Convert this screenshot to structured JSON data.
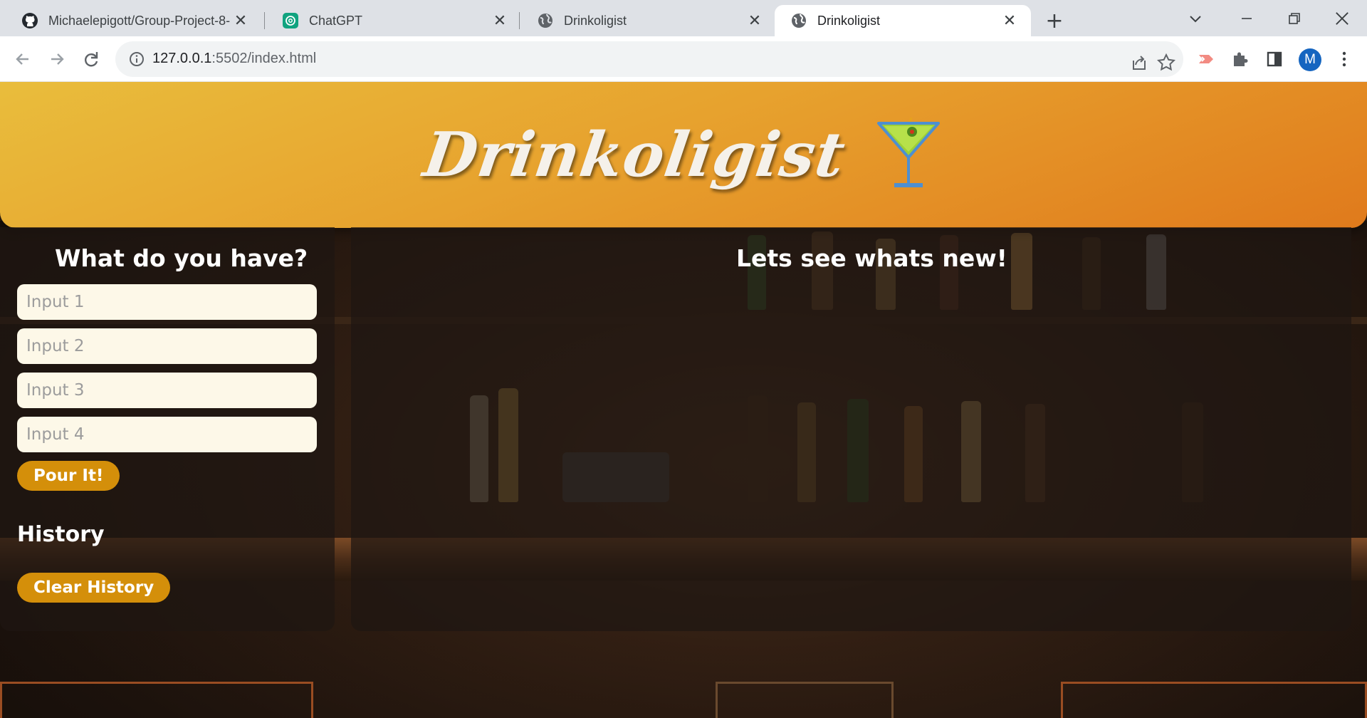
{
  "browser": {
    "tabs": [
      {
        "title": "Michaelepigott/Group-Project-8-",
        "icon": "github-icon",
        "active": false
      },
      {
        "title": "ChatGPT",
        "icon": "chatgpt-icon",
        "active": false
      },
      {
        "title": "Drinkoligist",
        "icon": "globe-icon",
        "active": false
      },
      {
        "title": "Drinkoligist",
        "icon": "globe-icon",
        "active": true
      }
    ],
    "tab_close_glyph": "✕",
    "new_tab_glyph": "+",
    "url_host": "127.0.0.1",
    "url_rest": ":5502/index.html",
    "profile_initial": "M"
  },
  "site": {
    "logo_text": "Drinkoligist",
    "logo_icon": "martini-icon"
  },
  "ingredients": {
    "heading": "What do you have?",
    "inputs": [
      {
        "placeholder": "Input 1",
        "value": ""
      },
      {
        "placeholder": "Input 2",
        "value": ""
      },
      {
        "placeholder": "Input 3",
        "value": ""
      },
      {
        "placeholder": "Input 4",
        "value": ""
      }
    ],
    "submit_label": "Pour It!"
  },
  "history": {
    "heading": "History",
    "clear_label": "Clear History"
  },
  "results": {
    "heading": "Lets see whats new!"
  },
  "colors": {
    "header_gradient_start": "#e9bd3c",
    "header_gradient_end": "#e07a1c",
    "button_bg": "#d48f0a",
    "input_bg": "#fdf8e8",
    "panel_bg": "rgba(30,22,18,0.72)"
  }
}
